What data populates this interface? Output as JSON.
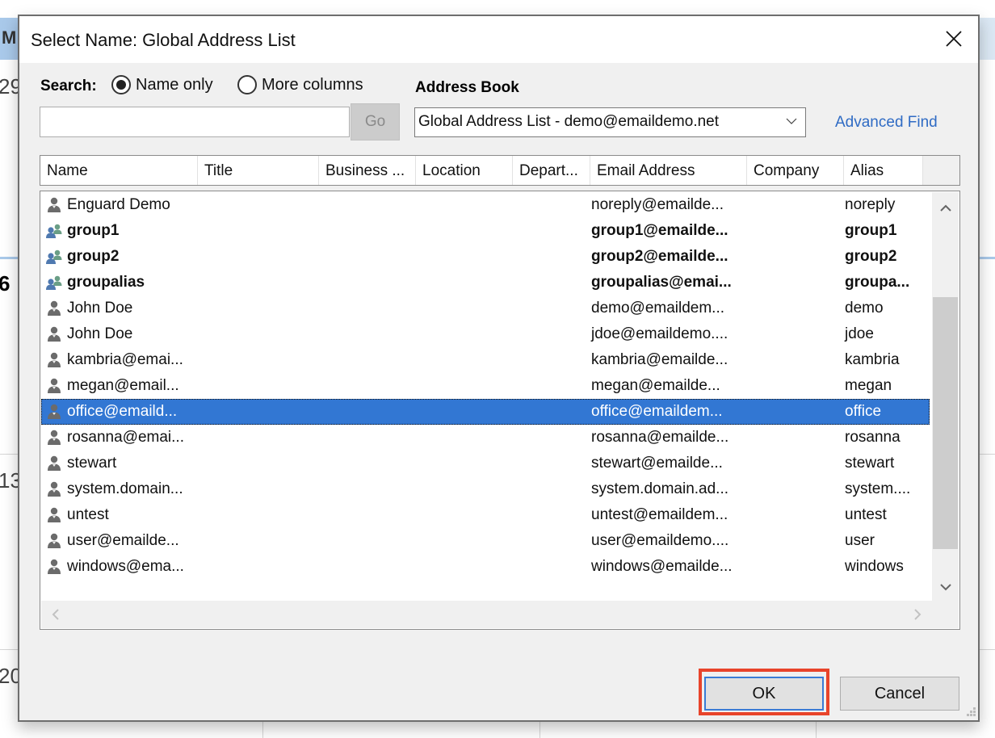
{
  "background": {
    "header_letter": "M",
    "dates": [
      "29",
      "6",
      "13",
      "20"
    ]
  },
  "dialog": {
    "title": "Select Name: Global Address List",
    "close_icon": "close-icon",
    "search": {
      "label": "Search:",
      "options": [
        {
          "label": "Name only",
          "selected": true
        },
        {
          "label": "More columns",
          "selected": false
        }
      ],
      "value": "",
      "go_label": "Go"
    },
    "address_book": {
      "label": "Address Book",
      "selected": "Global Address List - demo@emaildemo.net",
      "advanced_find_label": "Advanced Find"
    },
    "columns": [
      "Name",
      "Title",
      "Business ...",
      "Location",
      "Depart...",
      "Email Address",
      "Company",
      "Alias"
    ],
    "rows": [
      {
        "icon": "user-icon",
        "name": "Enguard Demo",
        "email": "noreply@emailde...",
        "alias": "noreply",
        "bold": false,
        "selected": false
      },
      {
        "icon": "group-icon",
        "name": "group1",
        "email": "group1@emailde...",
        "alias": "group1",
        "bold": true,
        "selected": false
      },
      {
        "icon": "group-icon",
        "name": "group2",
        "email": "group2@emailde...",
        "alias": "group2",
        "bold": true,
        "selected": false
      },
      {
        "icon": "group-icon",
        "name": "groupalias",
        "email": "groupalias@emai...",
        "alias": "groupa...",
        "bold": true,
        "selected": false
      },
      {
        "icon": "user-icon",
        "name": "John Doe",
        "email": "demo@emaildem...",
        "alias": "demo",
        "bold": false,
        "selected": false
      },
      {
        "icon": "user-icon",
        "name": "John Doe",
        "email": "jdoe@emaildemo....",
        "alias": "jdoe",
        "bold": false,
        "selected": false
      },
      {
        "icon": "user-icon",
        "name": "kambria@emai...",
        "email": "kambria@emailde...",
        "alias": "kambria",
        "bold": false,
        "selected": false
      },
      {
        "icon": "user-icon",
        "name": "megan@email...",
        "email": "megan@emailde...",
        "alias": "megan",
        "bold": false,
        "selected": false
      },
      {
        "icon": "user-icon",
        "name": "office@emaild...",
        "email": "office@emaildem...",
        "alias": "office",
        "bold": false,
        "selected": true
      },
      {
        "icon": "user-icon",
        "name": "rosanna@emai...",
        "email": "rosanna@emailde...",
        "alias": "rosanna",
        "bold": false,
        "selected": false
      },
      {
        "icon": "user-icon",
        "name": "stewart",
        "email": "stewart@emailde...",
        "alias": "stewart",
        "bold": false,
        "selected": false
      },
      {
        "icon": "user-icon",
        "name": "system.domain...",
        "email": "system.domain.ad...",
        "alias": "system....",
        "bold": false,
        "selected": false
      },
      {
        "icon": "user-icon",
        "name": "untest",
        "email": "untest@emaildem...",
        "alias": "untest",
        "bold": false,
        "selected": false
      },
      {
        "icon": "user-icon",
        "name": "user@emailde...",
        "email": "user@emaildemo....",
        "alias": "user",
        "bold": false,
        "selected": false
      },
      {
        "icon": "user-icon",
        "name": "windows@ema...",
        "email": "windows@emailde...",
        "alias": "windows",
        "bold": false,
        "selected": false
      }
    ],
    "buttons": {
      "ok": "OK",
      "cancel": "Cancel"
    },
    "colors": {
      "selection": "#3277d3",
      "link": "#2f6bc4",
      "highlight_box": "#e8442b",
      "group_icon_blue": "#4f79b0",
      "group_icon_green": "#6a9e86",
      "user_icon": "#6b6b6b"
    }
  }
}
